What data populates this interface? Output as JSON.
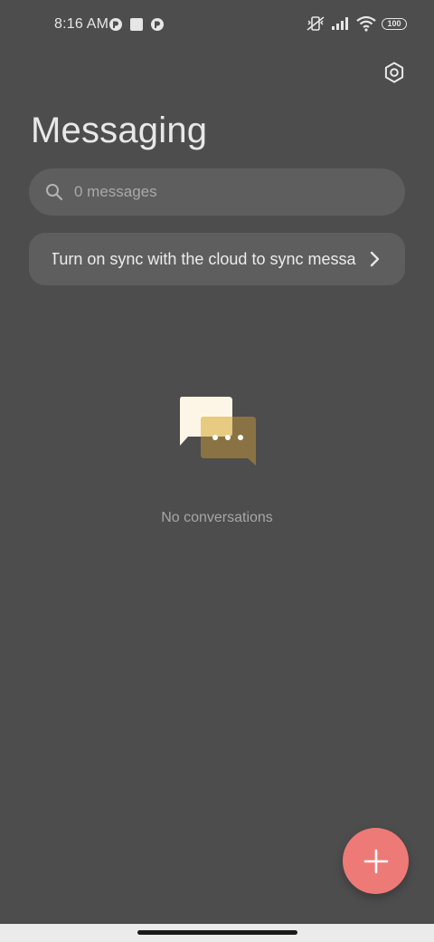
{
  "status_bar": {
    "time": "8:16 AM",
    "battery": "100"
  },
  "header": {
    "title": "Messaging",
    "settings_icon": "gear-icon"
  },
  "search": {
    "placeholder": "0 messages",
    "icon": "search-icon"
  },
  "sync_banner": {
    "text": "Turn on sync with the cloud to sync messages",
    "icon": "chevron-right-icon"
  },
  "empty_state": {
    "text": "No conversations",
    "icon": "chat-bubbles-icon"
  },
  "fab": {
    "icon": "plus-icon"
  },
  "colors": {
    "background": "#4d4d4d",
    "surface": "#5e5e5e",
    "accent": "#ee7a77",
    "text_primary": "#e8e8e8",
    "text_secondary": "#a6a6a6"
  }
}
